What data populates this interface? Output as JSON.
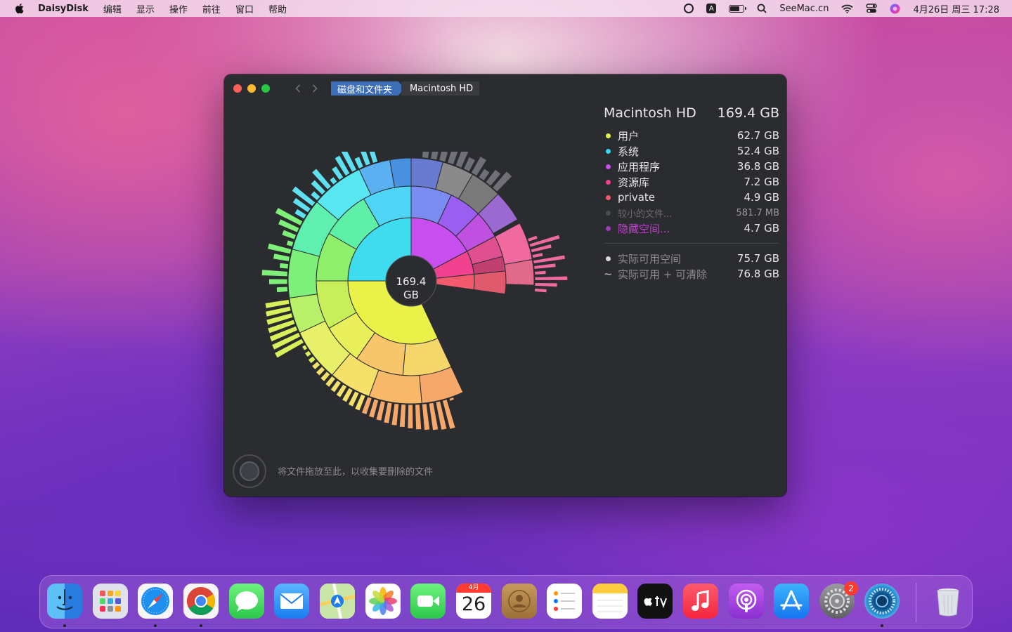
{
  "menubar": {
    "app_name": "DaisyDisk",
    "menus": [
      "编辑",
      "显示",
      "操作",
      "前往",
      "窗口",
      "帮助"
    ],
    "input_method": "A",
    "site": "SeeMac.cn",
    "datetime": "4月26日 周三  17:28",
    "battery_level": 0.75
  },
  "window": {
    "breadcrumb": [
      "磁盘和文件夹",
      "Macintosh HD"
    ],
    "center_size": "169.4",
    "center_unit": "GB",
    "disk": {
      "name": "Macintosh HD",
      "size": "169.4 GB"
    },
    "categories": [
      {
        "name": "用户",
        "value": "62.7 GB",
        "color": "#e4f04a"
      },
      {
        "name": "系统",
        "value": "52.4 GB",
        "color": "#39d6f0"
      },
      {
        "name": "应用程序",
        "value": "36.8 GB",
        "color": "#c84ef0"
      },
      {
        "name": "资源库",
        "value": "7.2 GB",
        "color": "#f0428e"
      },
      {
        "name": "private",
        "value": "4.9 GB",
        "color": "#f45a6e"
      }
    ],
    "smaller_files": {
      "name": "较小的文件...",
      "value": "581.7  MB",
      "color": "#4a4b50"
    },
    "hidden_space": {
      "name": "隐藏空间...",
      "value": "4.7 GB",
      "color": "#9a40b8"
    },
    "free_space": {
      "name": "实际可用空间",
      "value": "75.7 GB"
    },
    "free_purgeable": {
      "tilde": "~",
      "name": "实际可用 + 可清除",
      "value": "76.8 GB"
    },
    "drop_hint": "将文件拖放至此，以收集要删除的文件"
  },
  "dock": {
    "calendar_month": "4月",
    "calendar_day": "26",
    "settings_badge": "2",
    "apps": [
      "finder-icon",
      "launchpad-icon",
      "safari-icon",
      "chrome-icon",
      "messages-icon",
      "mail-icon",
      "maps-icon",
      "photos-icon",
      "facetime-icon",
      "calendar-icon",
      "contacts-icon",
      "reminders-icon",
      "notes-icon",
      "appletv-icon",
      "music-icon",
      "podcasts-icon",
      "appstore-icon",
      "settings-icon",
      "daisydisk-icon",
      "trash-icon"
    ]
  }
}
